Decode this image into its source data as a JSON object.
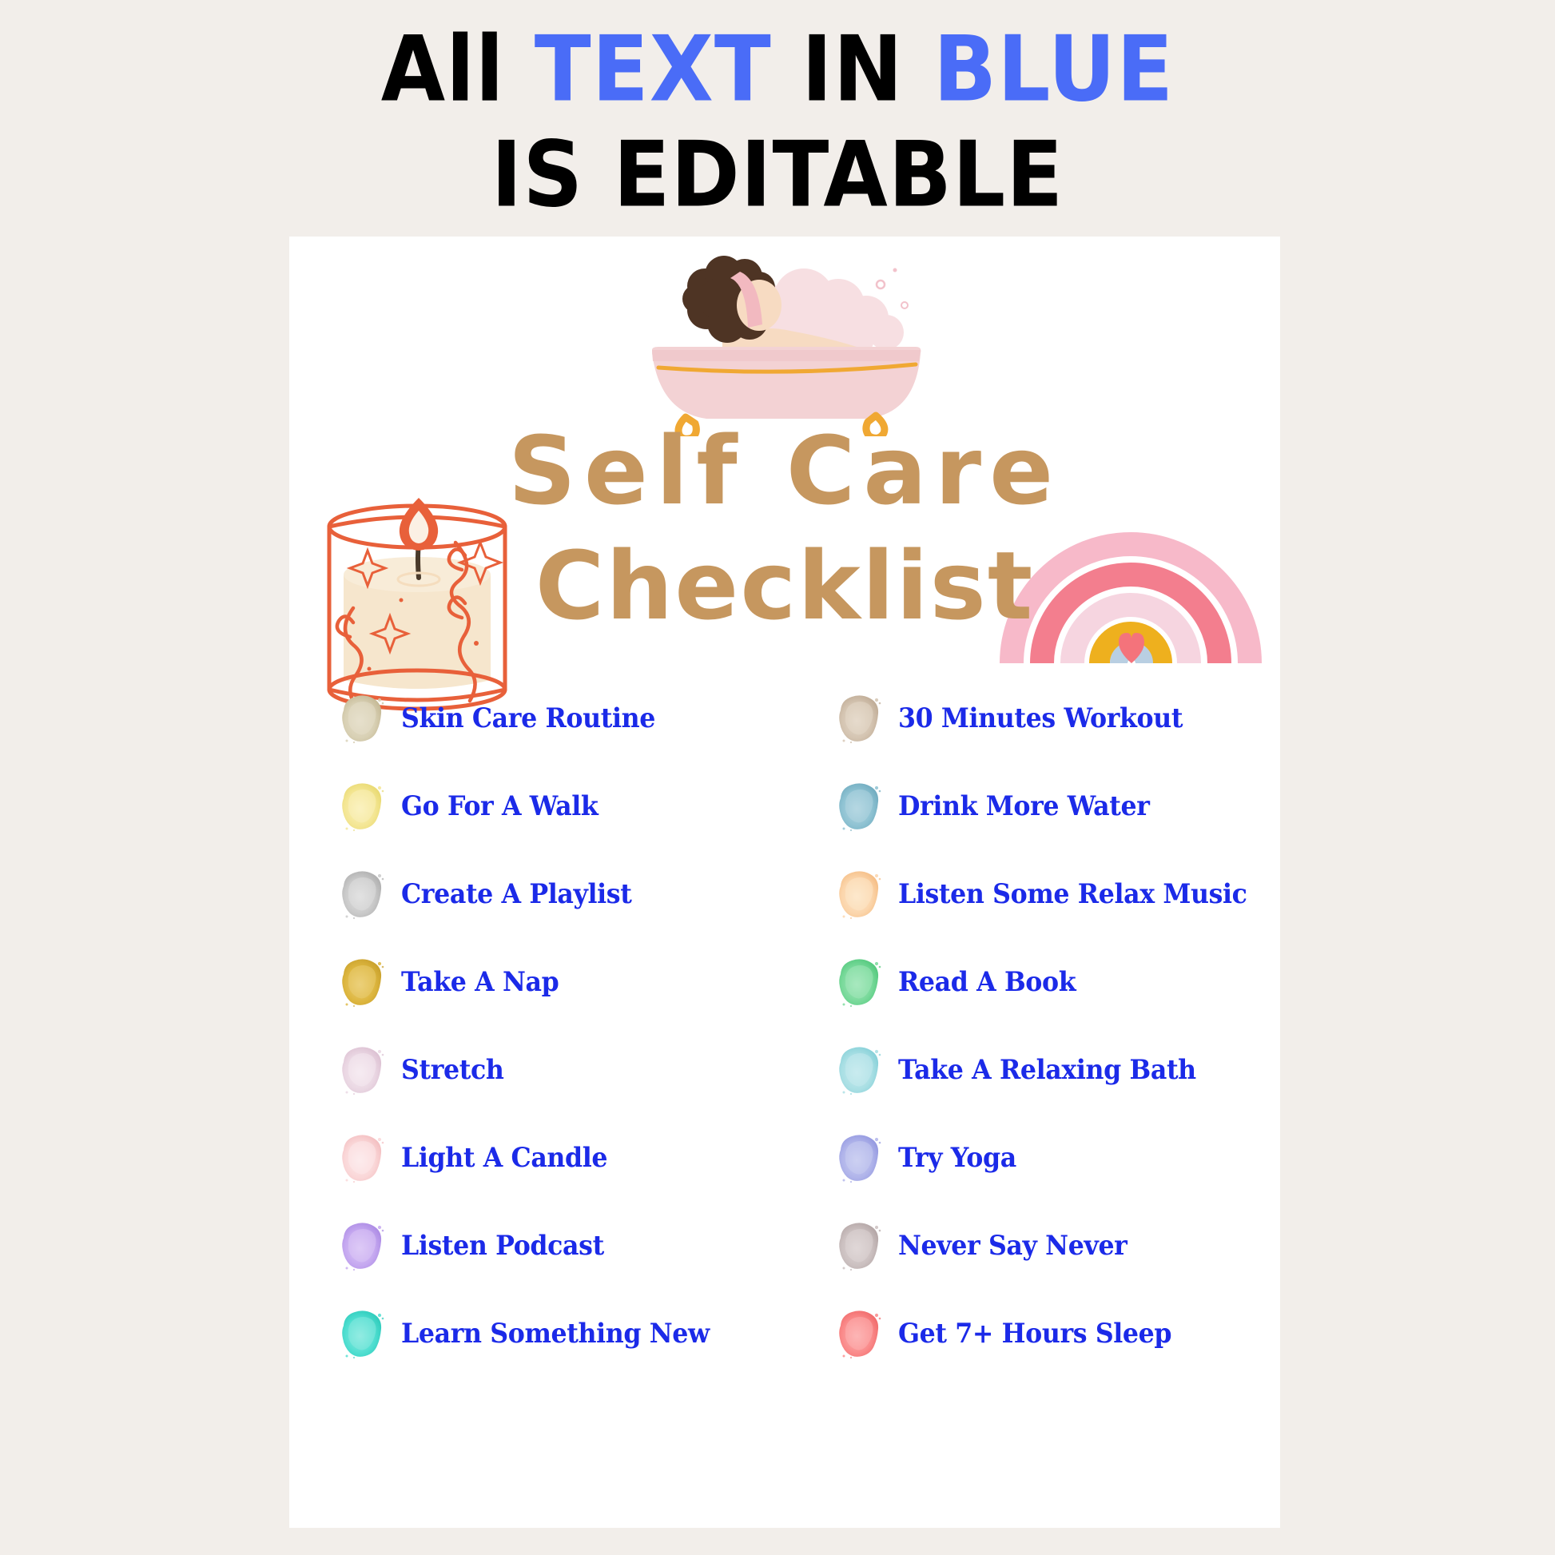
{
  "banner": {
    "line1_parts": [
      {
        "text": "All ",
        "highlight": false
      },
      {
        "text": "TEXT ",
        "highlight": true
      },
      {
        "text": "IN ",
        "highlight": false
      },
      {
        "text": "BLUE",
        "highlight": true
      }
    ],
    "line1_plain": "All TEXT IN BLUE",
    "line2": "IS EDITABLE",
    "highlight_color": "#4a6cf7",
    "base_color": "#000000"
  },
  "page": {
    "background": "#f2eeea",
    "sheet_background": "#ffffff"
  },
  "title": {
    "line1": "Self  Care",
    "line2": "Checklist",
    "color": "#c6975f"
  },
  "illustrations": [
    {
      "name": "bathtub-illustration",
      "description": "Person with dark curly hair relaxing in a pink clawfoot bathtub with bubbles",
      "colors": {
        "tub": "#f3d2d4",
        "tub_rim": "#f0c9cc",
        "feet": "#f0a833",
        "hair": "#4e3424",
        "skin": "#f7dbc2",
        "bubbles": "#f7dfe2",
        "headband": "#f2b9c0"
      }
    },
    {
      "name": "candle-illustration",
      "description": "Line-art candle in a glass jar with sparkles and vines",
      "colors": {
        "outline": "#e8603a",
        "wax": "#f6e6cd",
        "flame": "#e8603a",
        "wick": "#4a3a2a"
      }
    },
    {
      "name": "rainbow-illustration",
      "description": "Five-arc pastel rainbow with a coral heart at the center",
      "arcs": [
        "#f7b9c9",
        "#f37e8e",
        "#f6d5e0",
        "#eeb01e",
        "#b9cfe2"
      ],
      "heart_color": "#f4737b"
    }
  ],
  "checklist": {
    "columns": 2,
    "left": [
      {
        "label": "Skin Care Routine",
        "blob_color": "#d8d0b4",
        "blob_dark": "#c4b894",
        "blob_light": "#e6e0cc"
      },
      {
        "label": "Go For A Walk",
        "blob_color": "#f4e694",
        "blob_dark": "#e8d970",
        "blob_light": "#faf2c0"
      },
      {
        "label": "Create A Playlist",
        "blob_color": "#c9c9c9",
        "blob_dark": "#aeaeae",
        "blob_light": "#e2e2e2"
      },
      {
        "label": "Take A Nap",
        "blob_color": "#ddb63f",
        "blob_dark": "#c8a02c",
        "blob_light": "#ecd07a"
      },
      {
        "label": "Stretch",
        "blob_color": "#ead7e3",
        "blob_dark": "#dcc0d2",
        "blob_light": "#f6ecf2"
      },
      {
        "label": "Light A Candle",
        "blob_color": "#fad7d8",
        "blob_dark": "#f3bec0",
        "blob_light": "#fdeced"
      },
      {
        "label": "Listen Podcast",
        "blob_color": "#c5a8f0",
        "blob_dark": "#ab8ae4",
        "blob_light": "#ddcaf7"
      },
      {
        "label": "Learn Something New",
        "blob_color": "#4fded0",
        "blob_dark": "#2ecbbb",
        "blob_light": "#92ece2"
      }
    ],
    "right": [
      {
        "label": "30 Minutes Workout",
        "blob_color": "#d4c4b1",
        "blob_dark": "#bfab95",
        "blob_light": "#e6dbcd"
      },
      {
        "label": "Drink More Water",
        "blob_color": "#8ec2d2",
        "blob_dark": "#6fabbf",
        "blob_light": "#b6d8e3"
      },
      {
        "label": "Listen Some Relax Music",
        "blob_color": "#fbd5ab",
        "blob_dark": "#f5bd84",
        "blob_light": "#fde8cd"
      },
      {
        "label": "Read A Book",
        "blob_color": "#78d99a",
        "blob_dark": "#52c87c",
        "blob_light": "#a8e8bf"
      },
      {
        "label": "Take A Relaxing Bath",
        "blob_color": "#a9dfe4",
        "blob_dark": "#85d0d8",
        "blob_light": "#c9ecef"
      },
      {
        "label": "Try Yoga",
        "blob_color": "#b0b4ea",
        "blob_dark": "#9398e0",
        "blob_light": "#cdd0f2"
      },
      {
        "label": "Never Say Never",
        "blob_color": "#cbc0c0",
        "blob_dark": "#b3a5a5",
        "blob_light": "#e0d8d8"
      },
      {
        "label": "Get 7+ Hours Sleep",
        "blob_color": "#fa8a8a",
        "blob_dark": "#f06a6a",
        "blob_light": "#fcb5b5"
      }
    ],
    "text_color": "#1b2ae8"
  }
}
